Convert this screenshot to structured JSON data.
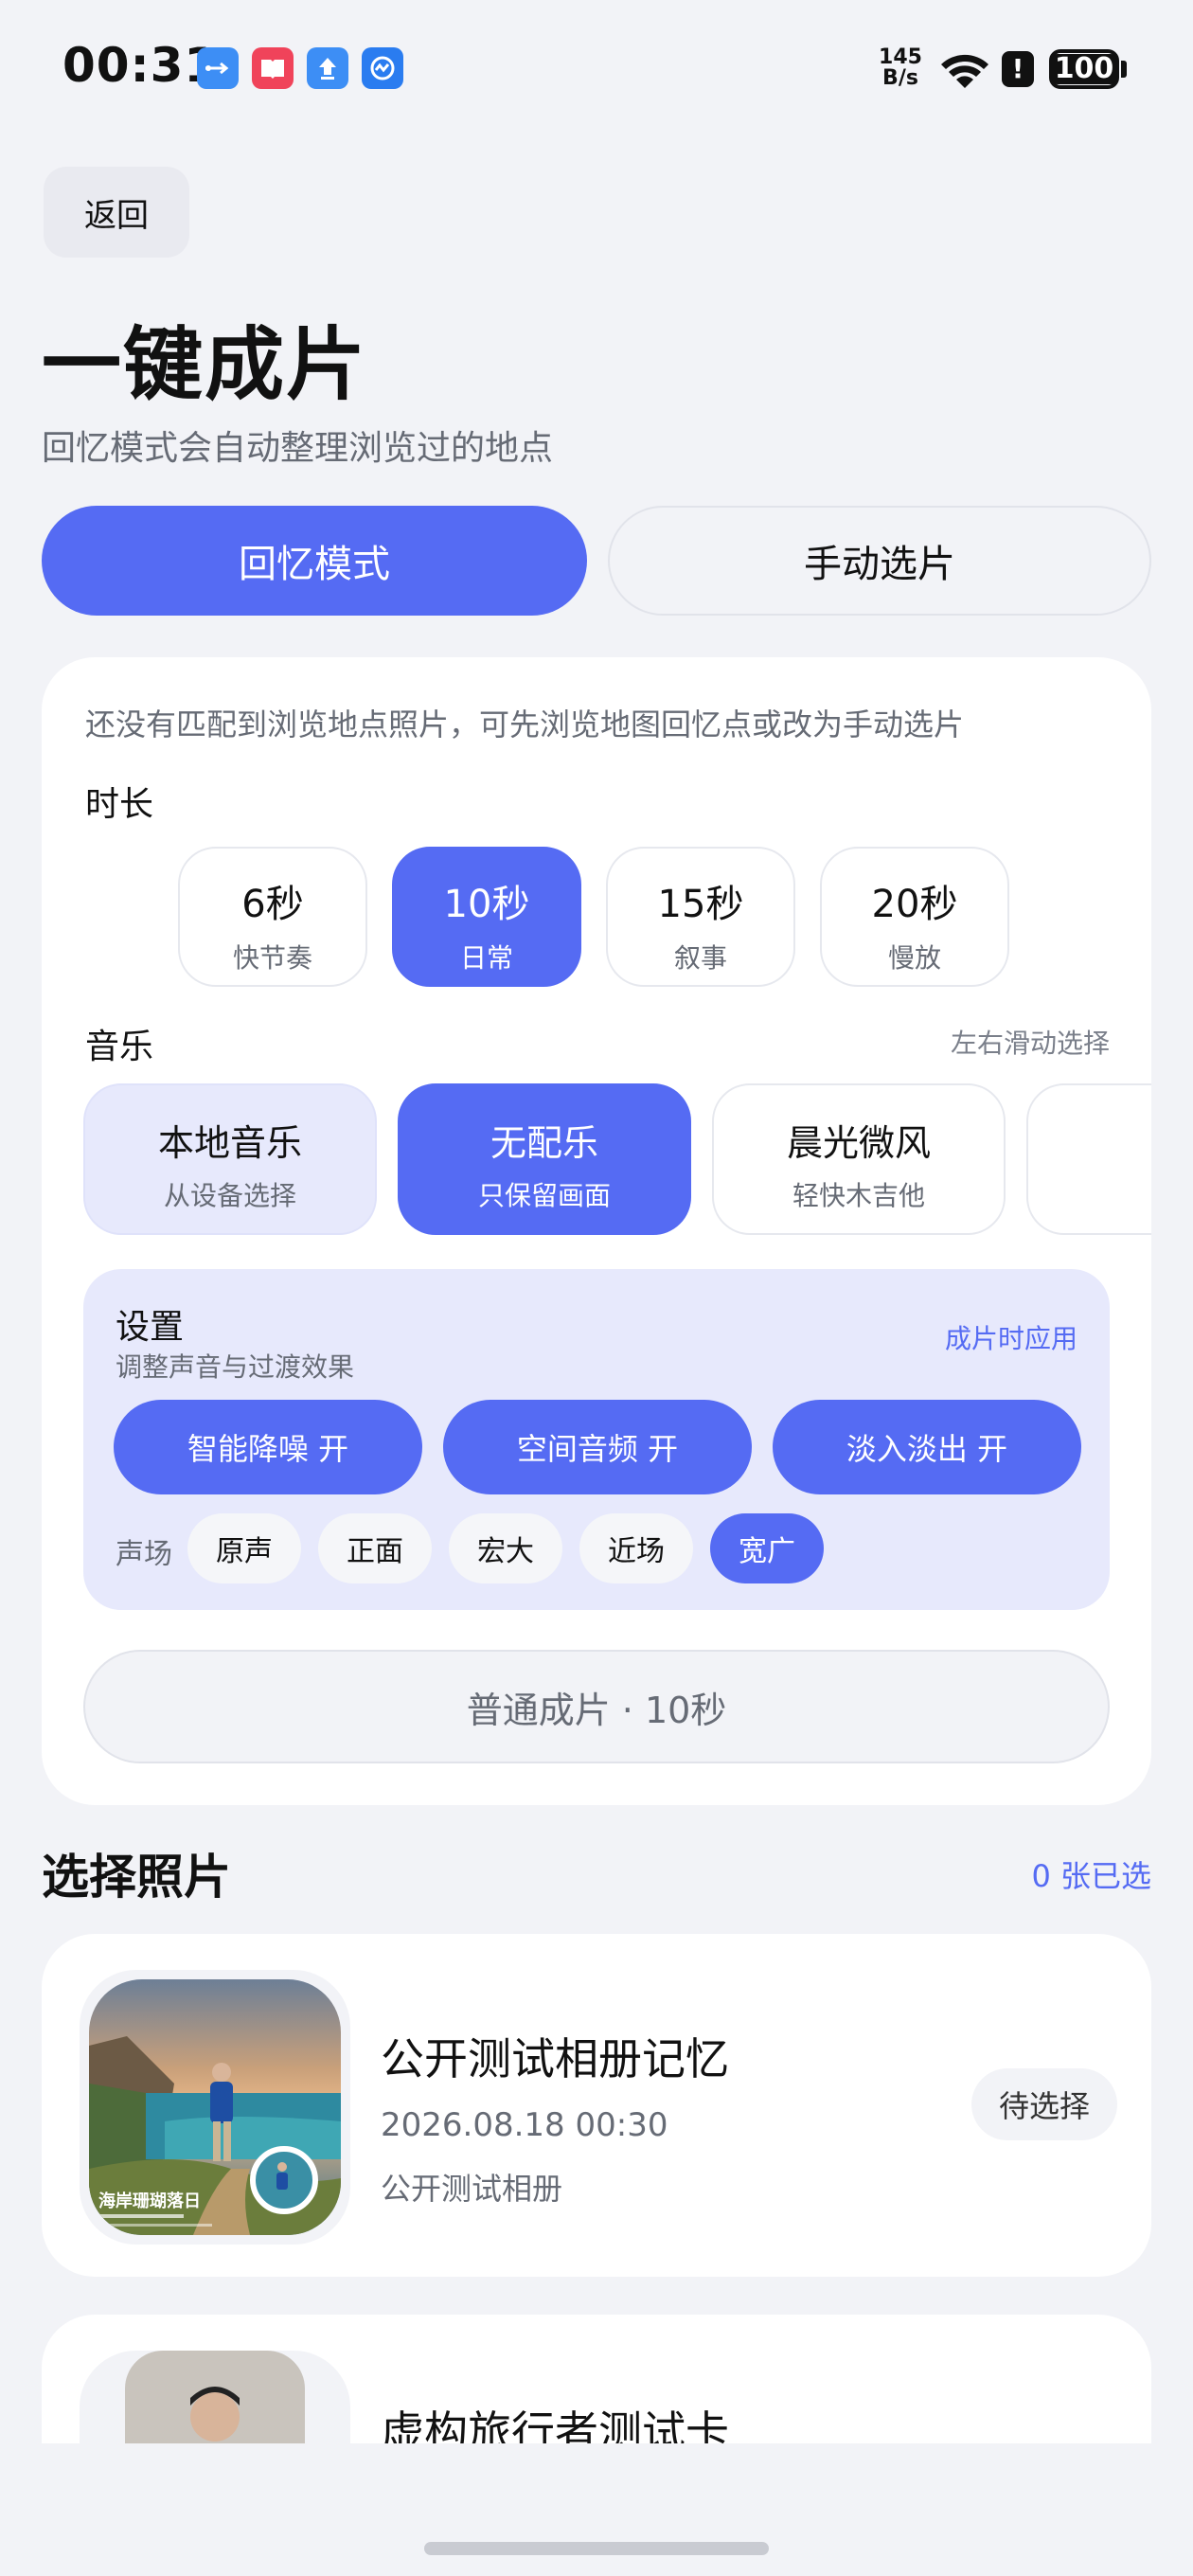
{
  "status_bar": {
    "time": "00:31",
    "net_speed_value": "145",
    "net_speed_unit": "B/s",
    "battery": "100",
    "alert_glyph": "!"
  },
  "header": {
    "back_label": "返回",
    "title": "一键成片",
    "subtitle": "回忆模式会自动整理浏览过的地点"
  },
  "mode_tabs": [
    {
      "label": "回忆模式",
      "active": true
    },
    {
      "label": "手动选片",
      "active": false
    }
  ],
  "config": {
    "hint": "还没有匹配到浏览地点照片，可先浏览地图回忆点或改为手动选片",
    "duration_label": "时长",
    "durations": [
      {
        "value": "6秒",
        "desc": "快节奏"
      },
      {
        "value": "10秒",
        "desc": "日常",
        "selected": true
      },
      {
        "value": "15秒",
        "desc": "叙事"
      },
      {
        "value": "20秒",
        "desc": "慢放"
      }
    ],
    "music_label": "音乐",
    "music_hint": "左右滑动选择",
    "music": [
      {
        "name": "本地音乐",
        "sub": "从设备选择"
      },
      {
        "name": "无配乐",
        "sub": "只保留画面",
        "selected": true
      },
      {
        "name": "晨光微风",
        "sub": "轻快木吉他"
      }
    ],
    "settings": {
      "title": "设置",
      "subtitle": "调整声音与过渡效果",
      "apply_hint": "成片时应用",
      "toggles": [
        "智能降噪 开",
        "空间音频 开",
        "淡入淡出 开"
      ],
      "soundfield_label": "声场",
      "soundfield_options": [
        "原声",
        "正面",
        "宏大",
        "近场",
        "宽广"
      ],
      "soundfield_selected": "宽广"
    },
    "generate_label": "普通成片 · 10秒"
  },
  "photos": {
    "title": "选择照片",
    "count_label": "0 张已选",
    "items": [
      {
        "title": "公开测试相册记忆",
        "date": "2026.08.18 00:30",
        "album": "公开测试相册",
        "status": "待选择",
        "thumb_caption": "海岸珊瑚落日"
      },
      {
        "title": "虚构旅行者测试卡"
      }
    ]
  },
  "colors": {
    "accent": "#556bf3",
    "panel": "#e7e9fc",
    "background": "#f2f3f7"
  }
}
